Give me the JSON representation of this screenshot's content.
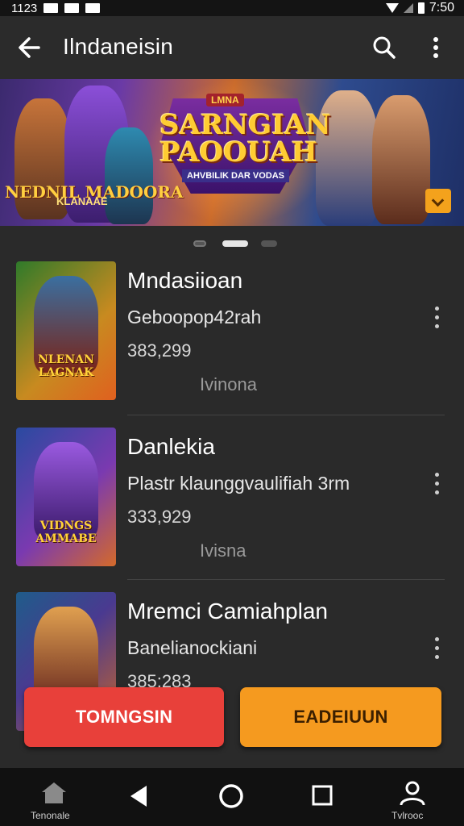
{
  "status_bar": {
    "time_left": "1123",
    "time_right": "7:50"
  },
  "app_bar": {
    "title": "Ilndaneisin",
    "back_icon": "arrow-left-icon",
    "search_icon": "search-icon",
    "more_icon": "more-vert-icon"
  },
  "banner": {
    "logo_top": "LMNA",
    "logo_main_line1": "SARNGIAN",
    "logo_main_line2": "PAOOUAH",
    "logo_sub": "AHVBILIK DAR VODAS",
    "left_title": "NEDNIL MADOORA",
    "left_subtitle": "KLANAAE",
    "badge_icon": "chevron-down-icon",
    "page_indicator": {
      "count": 3,
      "active": 1
    }
  },
  "games": [
    {
      "name": "Mndasiioan",
      "subtitle": "Geboopop42rah",
      "count": "383,299",
      "meta": "Ivinona",
      "thumb_label": "NLENAN LAGNAK",
      "thumb_colors": [
        "#3c7a2a",
        "#d38a22"
      ]
    },
    {
      "name": "Danlekia",
      "subtitle": "Plastr klaunggvaulifiah 3rm",
      "count": "333,929",
      "meta": "Ivisna",
      "thumb_label": "VIDNGS AMMABE",
      "thumb_colors": [
        "#2a4aa0",
        "#8a3ab0"
      ]
    },
    {
      "name": "Mremci Camiahplan",
      "subtitle": "Banelianockiani",
      "count": "385:283",
      "meta": "",
      "thumb_label": "",
      "thumb_colors": [
        "#1f5c8a",
        "#c4642a"
      ]
    }
  ],
  "buttons": {
    "primary": "TOMNGSIN",
    "secondary": "EADEIUUN"
  },
  "nav": {
    "home_label": "Tenonale",
    "profile_label": "Tvlrooc",
    "icons": [
      "home-icon",
      "back-triangle-icon",
      "home-circle-icon",
      "recents-square-icon",
      "profile-icon"
    ]
  },
  "colors": {
    "primary_button": "#e8403a",
    "secondary_button": "#f59a1f",
    "background": "#2a2a2a"
  }
}
